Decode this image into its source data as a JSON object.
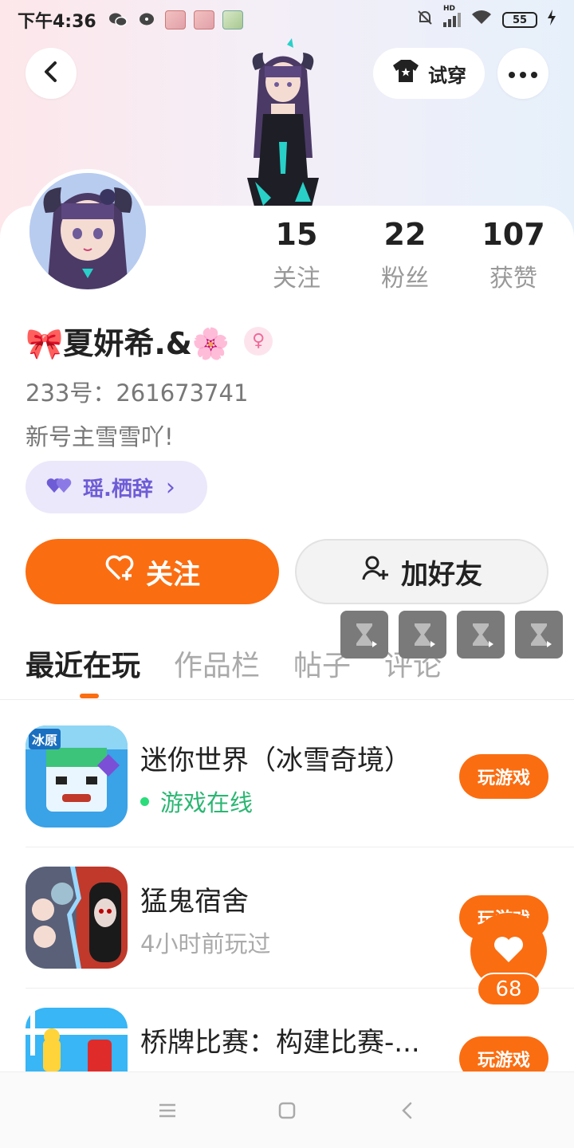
{
  "status_bar": {
    "time": "下午4:36",
    "battery": "55",
    "signal_label": "HD"
  },
  "header": {
    "tryon_label": "试穿"
  },
  "profile": {
    "name": "🎀夏妍希.&🌸",
    "gender_symbol": "♀",
    "uid": "233号：261673741",
    "bio": "新号主雪雪吖!",
    "tag_label": "瑶.栖辞",
    "tag_chevron": "›",
    "stats": [
      {
        "value": "15",
        "label": "关注"
      },
      {
        "value": "22",
        "label": "粉丝"
      },
      {
        "value": "107",
        "label": "获赞"
      }
    ]
  },
  "actions": {
    "follow_label": "关注",
    "add_friend_label": "加好友"
  },
  "tabs": [
    {
      "label": "最近在玩",
      "active": true
    },
    {
      "label": "作品栏",
      "active": false
    },
    {
      "label": "帖子",
      "active": false
    },
    {
      "label": "评论",
      "active": false
    }
  ],
  "games": [
    {
      "title": "迷你世界（冰雪奇境）",
      "status": "游戏在线",
      "online": true,
      "button": "玩游戏",
      "icon_text": "冰原"
    },
    {
      "title": "猛鬼宿舍",
      "status": "4小时前玩过",
      "online": false,
      "button": "玩游戏",
      "icon_text": ""
    },
    {
      "title": "桥牌比赛：构建比赛-...",
      "status": "",
      "online": false,
      "button": "玩游戏",
      "icon_text": ""
    }
  ],
  "like_float": {
    "count": "68"
  },
  "colors": {
    "accent": "#fb6d11",
    "tag_bg": "#ebe8fb",
    "tag_text": "#6e5cd6",
    "online": "#2bb673"
  },
  "icons": [
    "back-icon",
    "shirt-icon",
    "more-icon",
    "heart-plus-icon",
    "person-plus-icon",
    "hourglass-play-icon",
    "heart-icon",
    "menu-icon",
    "home-square-icon",
    "nav-back-icon"
  ]
}
